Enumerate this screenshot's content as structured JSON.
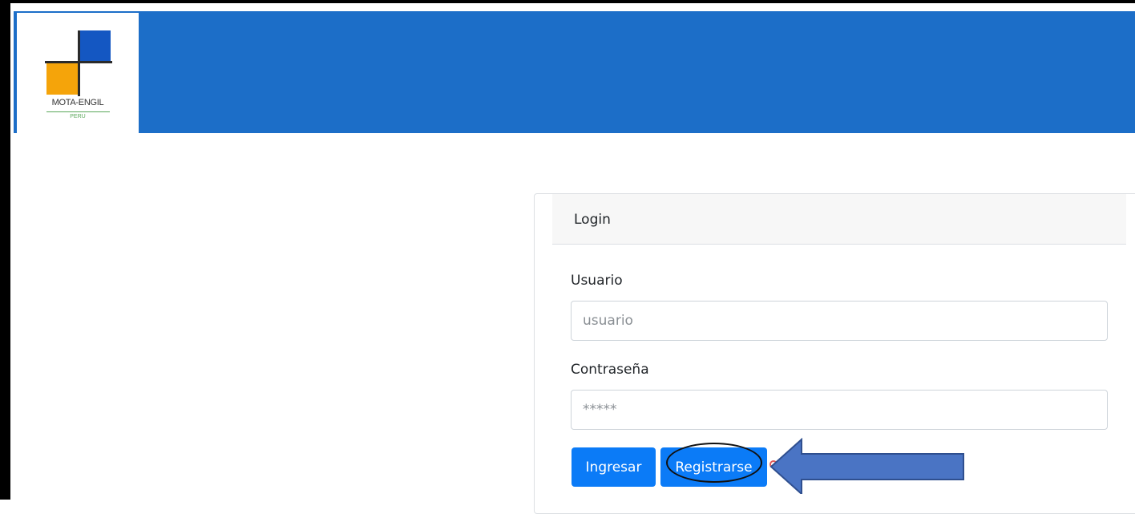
{
  "brand": {
    "name": "MOTA-ENGIL",
    "sub": "PERU",
    "colors": {
      "header": "#1c6ec8",
      "logo_blue": "#1457c2",
      "logo_orange": "#f5a40a",
      "accent_green": "#5aa85a",
      "button": "#0b7bf7"
    }
  },
  "login": {
    "title": "Login",
    "username_label": "Usuario",
    "username_placeholder": "usuario",
    "password_label": "Contraseña",
    "password_placeholder": "*****",
    "submit_label": "Ingresar",
    "register_label": "Registrarse"
  },
  "annotation": {
    "arrow_color": "#4a74c4",
    "highlight": "ellipse around Registrarse",
    "icons": [
      "left-arrow-icon"
    ]
  }
}
